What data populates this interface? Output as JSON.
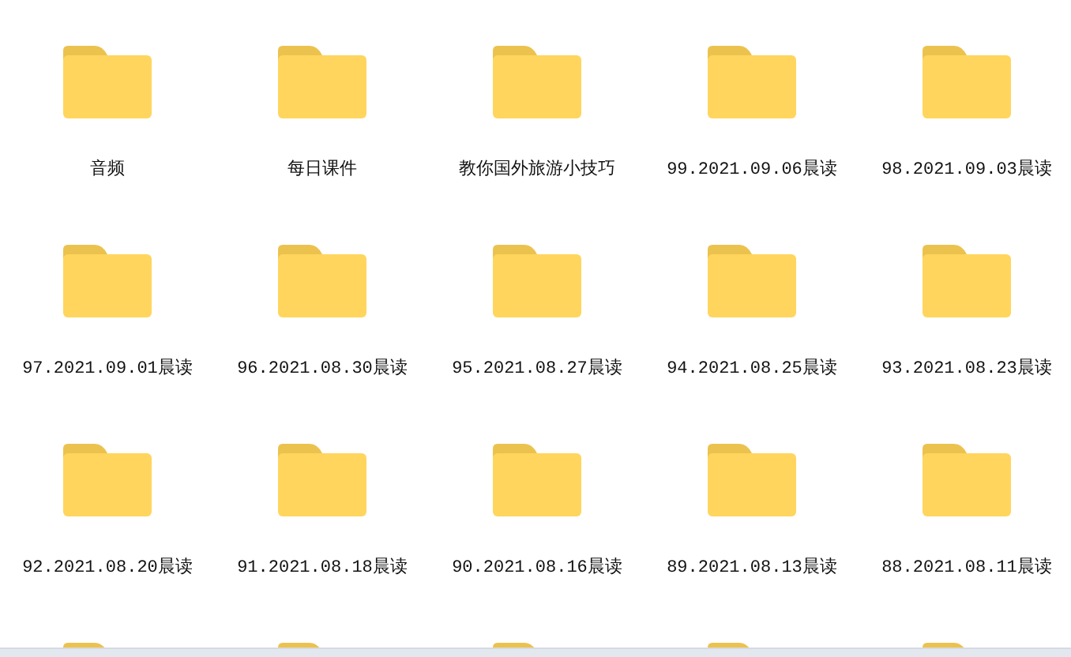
{
  "folders": [
    {
      "kind": "folder",
      "name": "音频"
    },
    {
      "kind": "folder",
      "name": "每日课件"
    },
    {
      "kind": "folder",
      "name": "教你国外旅游小技巧"
    },
    {
      "kind": "folder",
      "name": "99.2021.09.06晨读"
    },
    {
      "kind": "folder",
      "name": "98.2021.09.03晨读"
    },
    {
      "kind": "folder",
      "name": "97.2021.09.01晨读"
    },
    {
      "kind": "folder",
      "name": "96.2021.08.30晨读"
    },
    {
      "kind": "folder",
      "name": "95.2021.08.27晨读"
    },
    {
      "kind": "folder",
      "name": "94.2021.08.25晨读"
    },
    {
      "kind": "folder",
      "name": "93.2021.08.23晨读"
    },
    {
      "kind": "folder",
      "name": "92.2021.08.20晨读"
    },
    {
      "kind": "folder",
      "name": "91.2021.08.18晨读"
    },
    {
      "kind": "folder",
      "name": "90.2021.08.16晨读"
    },
    {
      "kind": "folder",
      "name": "89.2021.08.13晨读"
    },
    {
      "kind": "folder",
      "name": "88.2021.08.11晨读"
    },
    {
      "kind": "folder"
    },
    {
      "kind": "folder"
    },
    {
      "kind": "folder"
    },
    {
      "kind": "folder"
    },
    {
      "kind": "folder"
    }
  ]
}
